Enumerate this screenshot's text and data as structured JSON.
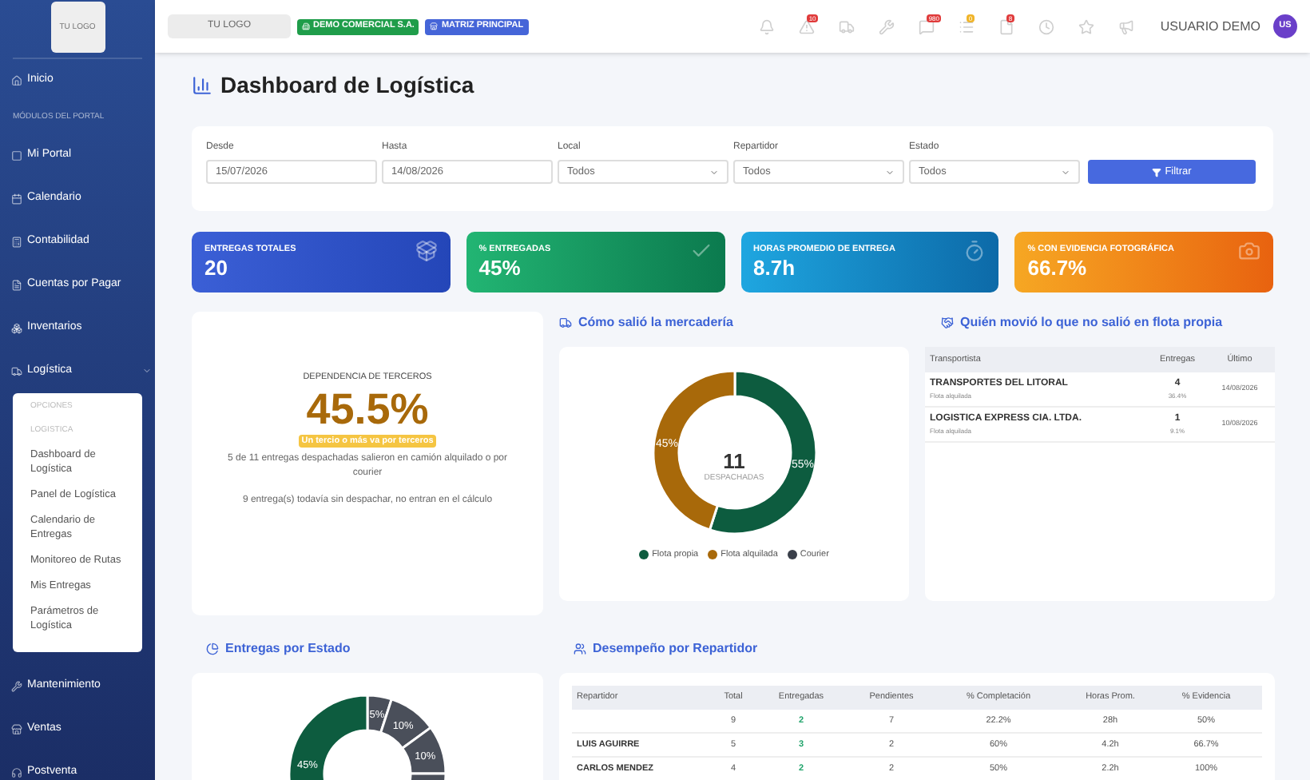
{
  "sidebar": {
    "logo": "TU LOGO",
    "items": [
      {
        "kind": "item",
        "label": "Inicio"
      },
      {
        "kind": "section",
        "label": "MÓDULOS DEL PORTAL"
      },
      {
        "kind": "item",
        "label": "Mi Portal"
      },
      {
        "kind": "item",
        "label": "Calendario"
      },
      {
        "kind": "item",
        "label": "Contabilidad"
      },
      {
        "kind": "item",
        "label": "Cuentas por Pagar"
      },
      {
        "kind": "item",
        "label": "Inventarios"
      },
      {
        "kind": "item",
        "label": "Logística",
        "expanded": true,
        "submenu": {
          "header": "OPCIONES",
          "group": "LOGISTICA",
          "children": [
            "Dashboard de Logística",
            "Panel de Logística",
            "Calendario de Entregas",
            "Monitoreo de Rutas",
            "Mis Entregas",
            "Parámetros de Logística"
          ]
        }
      },
      {
        "kind": "item",
        "label": "Mantenimiento"
      },
      {
        "kind": "item",
        "label": "Ventas"
      },
      {
        "kind": "item",
        "label": "Postventa"
      }
    ]
  },
  "topbar": {
    "logo": "TU LOGO",
    "company": "DEMO COMERCIAL S.A.",
    "branch": "MATRIZ PRINCIPAL",
    "icons": [
      {
        "kind": "bell"
      },
      {
        "kind": "alert",
        "count": "10"
      },
      {
        "kind": "truck"
      },
      {
        "kind": "tools"
      },
      {
        "kind": "chat",
        "count": "980"
      },
      {
        "kind": "list",
        "count": "0"
      },
      {
        "kind": "doc",
        "count": "8"
      },
      {
        "kind": "clock"
      },
      {
        "kind": "star"
      },
      {
        "kind": "megaphone"
      }
    ],
    "user": "USUARIO DEMO",
    "avatar": "US"
  },
  "title": "Dashboard de Logística",
  "filters": {
    "fields": [
      {
        "kind": "date",
        "label": "Desde",
        "value": "15/07/2026"
      },
      {
        "kind": "date",
        "label": "Hasta",
        "value": "14/08/2026"
      },
      {
        "kind": "select",
        "label": "Local",
        "value": "Todos"
      },
      {
        "kind": "select",
        "label": "Repartidor",
        "value": "Todos"
      },
      {
        "kind": "select",
        "label": "Estado",
        "value": "Todos"
      }
    ],
    "button": "Filtrar"
  },
  "kpis": [
    {
      "label": "ENTREGAS TOTALES",
      "value": "20",
      "kind": "dolly"
    },
    {
      "label": "% ENTREGADAS",
      "value": "45%",
      "kind": "check"
    },
    {
      "label": "HORAS PROMEDIO DE ENTREGA",
      "value": "8.7h",
      "kind": "timer"
    },
    {
      "label": "% CON EVIDENCIA FOTOGRÁFICA",
      "value": "66.7%",
      "kind": "camera"
    }
  ],
  "dependency": {
    "title": "DEPENDENCIA DE TERCEROS",
    "value": "45.5%",
    "badge": "Un tercio o más va por terceros",
    "text": "5 de 11 entregas despachadas salieron en camión alquilado o por courier",
    "note": "9 entrega(s) todavía sin despachar, no entran en el cálculo"
  },
  "shipping": {
    "title": "Cómo salió la mercadería",
    "center_value": "11",
    "center_label": "DESPACHADAS",
    "chart_data": {
      "type": "donut",
      "categories": [
        "Flota propia",
        "Flota alquilada",
        "Courier"
      ],
      "series": [
        {
          "values": [
            55,
            45,
            0
          ]
        }
      ],
      "colors": [
        "#0d5c3f",
        "#a8690a",
        "#3a3f4a"
      ],
      "value_labels": [
        "55%",
        "45%",
        null
      ]
    }
  },
  "carriers": {
    "title": "Quién movió lo que no salió en flota propia",
    "columns": [
      "Transportista",
      "Entregas",
      "Último"
    ],
    "rows": [
      {
        "name": "TRANSPORTES DEL LITORAL",
        "type": "Flota alquilada",
        "deliveries": "4",
        "share": "36.4%",
        "last": "14/08/2026"
      },
      {
        "name": "LOGISTICA EXPRESS CIA. LTDA.",
        "type": "Flota alquilada",
        "deliveries": "1",
        "share": "9.1%",
        "last": "10/08/2026"
      }
    ]
  },
  "states": {
    "title": "Entregas por Estado",
    "segment_labels": [
      "5%",
      "10%",
      "10%",
      "45%"
    ]
  },
  "performance": {
    "title": "Desempeño por Repartidor",
    "columns": [
      "Repartidor",
      "Total",
      "Entregadas",
      "Pendientes",
      "% Completación",
      "Horas Prom.",
      "% Evidencia"
    ],
    "rows": [
      {
        "values": [
          "9",
          "2",
          "7",
          "22.2%",
          "28h",
          "50%"
        ]
      },
      {
        "name": "LUIS AGUIRRE",
        "values": [
          "5",
          "3",
          "2",
          "60%",
          "4.2h",
          "66.7%"
        ]
      },
      {
        "name": "CARLOS MENDEZ",
        "values": [
          "4",
          "2",
          "2",
          "50%",
          "2.2h",
          "100%"
        ]
      }
    ]
  }
}
